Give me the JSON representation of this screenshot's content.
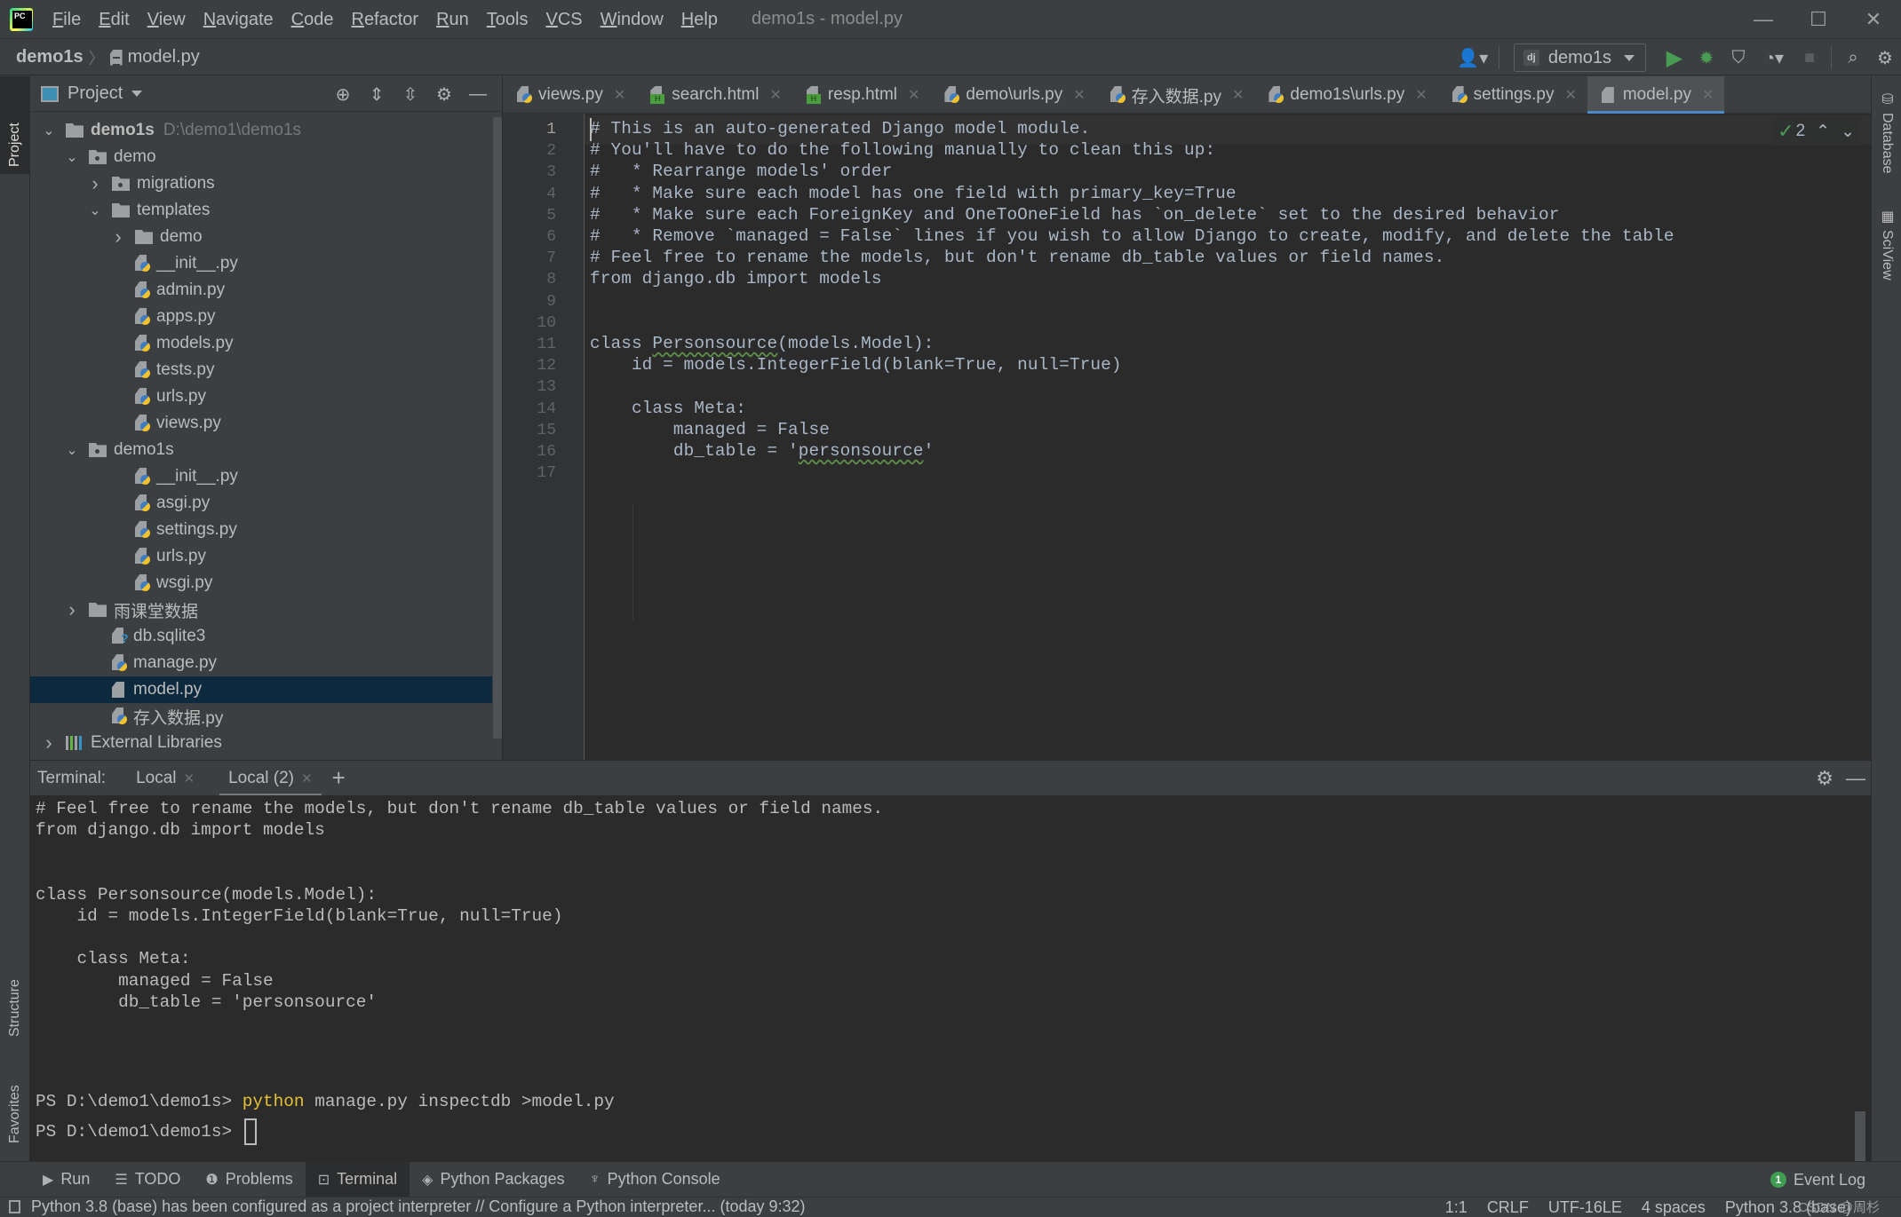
{
  "titlebar": {
    "menu": [
      "File",
      "Edit",
      "View",
      "Navigate",
      "Code",
      "Refactor",
      "Run",
      "Tools",
      "VCS",
      "Window",
      "Help"
    ],
    "window_title": "demo1s - model.py",
    "controls": {
      "minimize": "—",
      "maximize": "☐",
      "close": "✕"
    }
  },
  "navbar": {
    "breadcrumb_root": "demo1s",
    "breadcrumb_sep": "〉",
    "breadcrumb_file": "model.py",
    "run_config": "demo1s",
    "icons": [
      "user-icon",
      "run-icon",
      "debug-icon",
      "coverage-icon",
      "profile-icon",
      "stop-icon",
      "search-icon",
      "settings-icon"
    ]
  },
  "left_strip": {
    "project": "Project",
    "structure": "Structure",
    "favorites": "Favorites"
  },
  "right_strip": {
    "database": "Database",
    "sciview": "SciView"
  },
  "project_panel": {
    "title": "Project",
    "tree": [
      {
        "label": "demo1s",
        "hint": "D:\\demo1\\demo1s",
        "type": "folder",
        "depth": 0,
        "expanded": true,
        "bold": true
      },
      {
        "label": "demo",
        "type": "package",
        "depth": 1,
        "expanded": true
      },
      {
        "label": "migrations",
        "type": "package",
        "depth": 2,
        "expanded": false
      },
      {
        "label": "templates",
        "type": "folder",
        "depth": 2,
        "expanded": true
      },
      {
        "label": "demo",
        "type": "folder",
        "depth": 3,
        "expanded": false
      },
      {
        "label": "__init__.py",
        "type": "py",
        "depth": 3
      },
      {
        "label": "admin.py",
        "type": "py",
        "depth": 3
      },
      {
        "label": "apps.py",
        "type": "py",
        "depth": 3
      },
      {
        "label": "models.py",
        "type": "py",
        "depth": 3
      },
      {
        "label": "tests.py",
        "type": "py",
        "depth": 3
      },
      {
        "label": "urls.py",
        "type": "py",
        "depth": 3
      },
      {
        "label": "views.py",
        "type": "py",
        "depth": 3
      },
      {
        "label": "demo1s",
        "type": "package",
        "depth": 1,
        "expanded": true
      },
      {
        "label": "__init__.py",
        "type": "py",
        "depth": 3
      },
      {
        "label": "asgi.py",
        "type": "py",
        "depth": 3
      },
      {
        "label": "settings.py",
        "type": "py",
        "depth": 3
      },
      {
        "label": "urls.py",
        "type": "py",
        "depth": 3
      },
      {
        "label": "wsgi.py",
        "type": "py",
        "depth": 3
      },
      {
        "label": "雨课堂数据",
        "type": "folder",
        "depth": 1,
        "expanded": false
      },
      {
        "label": "db.sqlite3",
        "type": "unknown",
        "depth": 2
      },
      {
        "label": "manage.py",
        "type": "py",
        "depth": 2
      },
      {
        "label": "model.py",
        "type": "text",
        "depth": 2,
        "selected": true
      },
      {
        "label": "存入数据.py",
        "type": "py",
        "depth": 2
      },
      {
        "label": "External Libraries",
        "type": "libs",
        "depth": 0,
        "expanded": false
      }
    ]
  },
  "editor_tabs": [
    {
      "label": "views.py",
      "type": "py"
    },
    {
      "label": "search.html",
      "type": "html"
    },
    {
      "label": "resp.html",
      "type": "html"
    },
    {
      "label": "demo\\urls.py",
      "type": "py"
    },
    {
      "label": "存入数据.py",
      "type": "py"
    },
    {
      "label": "demo1s\\urls.py",
      "type": "py"
    },
    {
      "label": "settings.py",
      "type": "py"
    },
    {
      "label": "model.py",
      "type": "text",
      "active": true
    }
  ],
  "editor": {
    "inspection_count": "2",
    "lines": [
      "# This is an auto-generated Django model module.",
      "# You'll have to do the following manually to clean this up:",
      "#   * Rearrange models' order",
      "#   * Make sure each model has one field with primary_key=True",
      "#   * Make sure each ForeignKey and OneToOneField has `on_delete` set to the desired behavior",
      "#   * Remove `managed = False` lines if you wish to allow Django to create, modify, and delete the table",
      "# Feel free to rename the models, but don't rename db_table values or field names.",
      "from django.db import models",
      "",
      "",
      "class Personsource(models.Model):",
      "    id = models.IntegerField(blank=True, null=True)",
      "",
      "    class Meta:",
      "        managed = False",
      "        db_table = 'personsource'",
      ""
    ]
  },
  "terminal": {
    "label": "Terminal:",
    "tabs": [
      {
        "label": "Local"
      },
      {
        "label": "Local (2)",
        "active": true
      }
    ],
    "add": "+",
    "lines": [
      "# Feel free to rename the models, but don't rename db_table values or field names.",
      "from django.db import models",
      "",
      "",
      "class Personsource(models.Model):",
      "    id = models.IntegerField(blank=True, null=True)",
      "",
      "    class Meta:",
      "        managed = False",
      "        db_table = 'personsource'"
    ],
    "prompt": "PS D:\\demo1\\demo1s>",
    "command_keyword": "python",
    "command_rest": " manage.py inspectdb >model.py"
  },
  "tool_windows": [
    {
      "label": "Run",
      "icon": "run-icon"
    },
    {
      "label": "TODO",
      "icon": "todo-icon"
    },
    {
      "label": "Problems",
      "icon": "problems-icon"
    },
    {
      "label": "Terminal",
      "icon": "terminal-icon",
      "active": true
    },
    {
      "label": "Python Packages",
      "icon": "packages-icon"
    },
    {
      "label": "Python Console",
      "icon": "python-console-icon"
    }
  ],
  "event_log": {
    "label": "Event Log",
    "count": "1"
  },
  "statusbar": {
    "message": "Python 3.8 (base) has been configured as a project interpreter // Configure a Python interpreter... (today 9:32)",
    "position": "1:1",
    "line_sep": "CRLF",
    "encoding": "UTF-16LE",
    "indent": "4 spaces",
    "interpreter": "Python 3.8 (base)",
    "watermark": "CSDN @周杉"
  }
}
